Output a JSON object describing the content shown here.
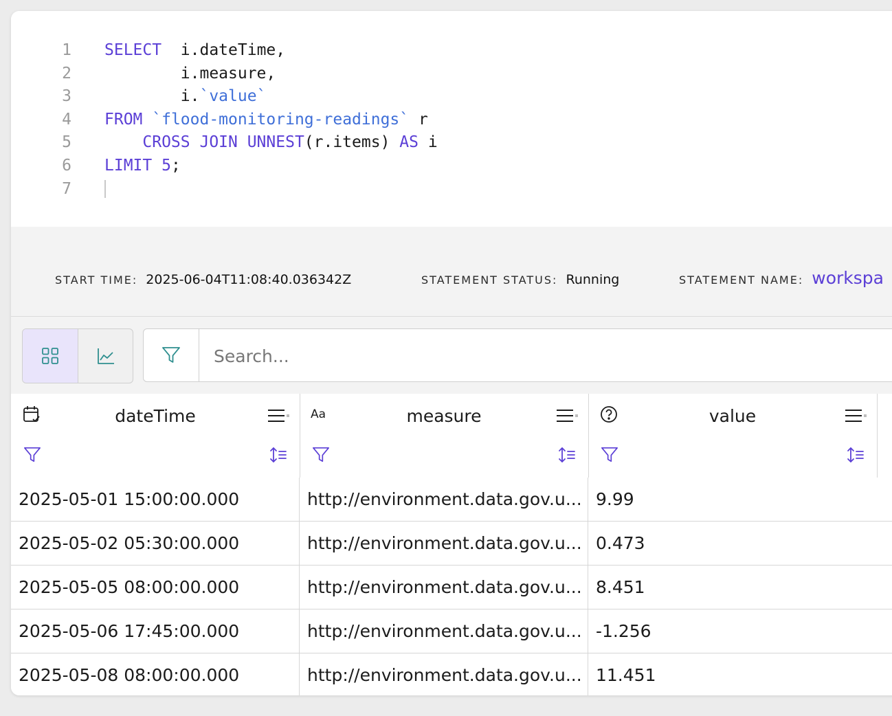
{
  "editor": {
    "lines": [
      {
        "n": "1",
        "parts": [
          {
            "t": "SELECT",
            "c": "kw"
          },
          {
            "t": "  i.dateTime,",
            "c": ""
          }
        ]
      },
      {
        "n": "2",
        "parts": [
          {
            "t": "        i.measure,",
            "c": ""
          }
        ]
      },
      {
        "n": "3",
        "parts": [
          {
            "t": "        i.",
            "c": ""
          },
          {
            "t": "`value`",
            "c": "str"
          }
        ]
      },
      {
        "n": "4",
        "parts": [
          {
            "t": "FROM",
            "c": "kw"
          },
          {
            "t": " ",
            "c": ""
          },
          {
            "t": "`flood-monitoring-readings`",
            "c": "str"
          },
          {
            "t": " r",
            "c": ""
          }
        ]
      },
      {
        "n": "5",
        "parts": [
          {
            "t": "    ",
            "c": ""
          },
          {
            "t": "CROSS JOIN UNNEST",
            "c": "kw"
          },
          {
            "t": "(r.items) ",
            "c": ""
          },
          {
            "t": "AS",
            "c": "kw"
          },
          {
            "t": " i",
            "c": ""
          }
        ]
      },
      {
        "n": "6",
        "parts": [
          {
            "t": "LIMIT",
            "c": "kw"
          },
          {
            "t": " ",
            "c": ""
          },
          {
            "t": "5",
            "c": "num"
          },
          {
            "t": ";",
            "c": ""
          }
        ]
      },
      {
        "n": "7",
        "parts": []
      }
    ]
  },
  "status": {
    "start_time_label": "START TIME:",
    "start_time_value": "2025-06-04T11:08:40.036342Z",
    "statement_status_label": "STATEMENT STATUS:",
    "statement_status_value": "Running",
    "statement_name_label": "STATEMENT NAME:",
    "statement_name_value": "workspa"
  },
  "toolbar": {
    "search_placeholder": "Search..."
  },
  "table": {
    "columns": [
      {
        "title": "dateTime",
        "type_icon": "calendar-icon"
      },
      {
        "title": "measure",
        "type_icon": "text-type-icon",
        "type_text": "Aa"
      },
      {
        "title": "value",
        "type_icon": "question-icon"
      }
    ],
    "rows": [
      [
        "2025-05-01 15:00:00.000",
        "http://environment.data.gov.u...",
        "9.99"
      ],
      [
        "2025-05-02 05:30:00.000",
        "http://environment.data.gov.u...",
        "0.473"
      ],
      [
        "2025-05-05 08:00:00.000",
        "http://environment.data.gov.u...",
        "8.451"
      ],
      [
        "2025-05-06 17:45:00.000",
        "http://environment.data.gov.u...",
        "-1.256"
      ],
      [
        "2025-05-08 08:00:00.000",
        "http://environment.data.gov.u...",
        "11.451"
      ]
    ]
  },
  "colors": {
    "accent": "#5b3fd6",
    "teal_icon": "#2f8f8f",
    "string": "#3f6fd8"
  }
}
